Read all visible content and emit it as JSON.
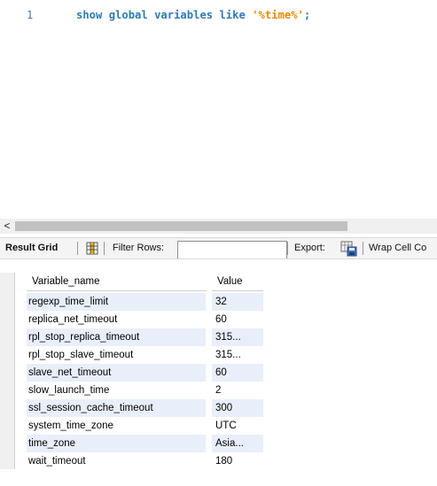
{
  "editor": {
    "line_number": "1",
    "code": {
      "kw1": "show",
      "kw2": "global",
      "kw3": "variables",
      "kw4": "like",
      "string": "'%time%'",
      "terminator": ";"
    }
  },
  "hscroll": {
    "left_arrow": "<"
  },
  "toolbar": {
    "result_grid_label": "Result Grid",
    "separator": "|",
    "filter_label": "Filter Rows:",
    "filter_value": "",
    "export_label": "Export:",
    "wrap_label": "Wrap Cell Co"
  },
  "grid": {
    "columns": [
      "Variable_name",
      "Value"
    ],
    "rows": [
      [
        "regexp_time_limit",
        "32"
      ],
      [
        "replica_net_timeout",
        "60"
      ],
      [
        "rpl_stop_replica_timeout",
        "315..."
      ],
      [
        "rpl_stop_slave_timeout",
        "315..."
      ],
      [
        "slave_net_timeout",
        "60"
      ],
      [
        "slow_launch_time",
        "2"
      ],
      [
        "ssl_session_cache_timeout",
        "300"
      ],
      [
        "system_time_zone",
        "UTC"
      ],
      [
        "time_zone",
        "Asia..."
      ],
      [
        "wait_timeout",
        "180"
      ]
    ]
  },
  "colors": {
    "keyword": "#2a7bbd",
    "string": "#ef8a00",
    "row_stripe": "#e8effa"
  },
  "icons": [
    "grid-layout-icon",
    "export-save-icon",
    "scroll-left-arrow-icon"
  ]
}
